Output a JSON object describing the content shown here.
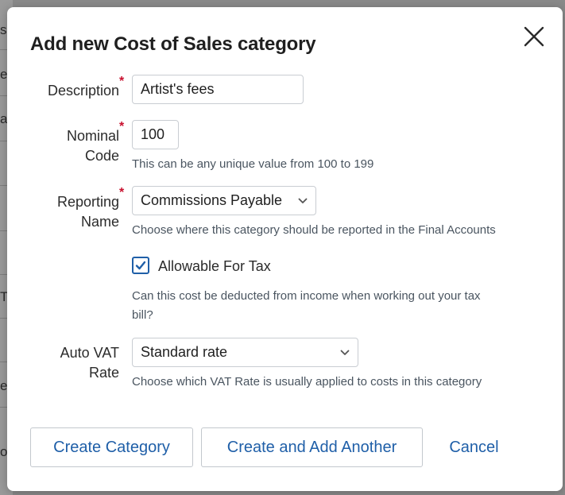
{
  "background": {
    "fragments": [
      "s",
      "e",
      "a",
      "T",
      "ea",
      "o"
    ]
  },
  "dialog": {
    "title": "Add new Cost of Sales category",
    "close_icon": "close-icon",
    "required_marker": "*",
    "description": {
      "label": "Description",
      "value": "Artist's fees"
    },
    "nominal_code": {
      "label_line1": "Nominal",
      "label_line2": "Code",
      "value": "100",
      "help": "This can be any unique value from 100 to 199"
    },
    "reporting_name": {
      "label_line1": "Reporting",
      "label_line2": "Name",
      "selected": "Commissions Payable",
      "help": "Choose where this category should be reported in the Final Accounts"
    },
    "allowable_for_tax": {
      "label": "Allowable For Tax",
      "checked": true,
      "help_line1": "Can this cost be deducted from income when working out your tax",
      "help_line2": "bill?"
    },
    "auto_vat_rate": {
      "label_line1": "Auto VAT",
      "label_line2": "Rate",
      "selected": "Standard rate",
      "help": "Choose which VAT Rate is usually applied to costs in this category"
    },
    "buttons": {
      "create": "Create Category",
      "create_another": "Create and Add Another",
      "cancel": "Cancel"
    }
  },
  "colors": {
    "accent": "#1f5fa8",
    "required": "#c8102e",
    "help_text": "#4a5560",
    "border": "#c9cdd2"
  }
}
